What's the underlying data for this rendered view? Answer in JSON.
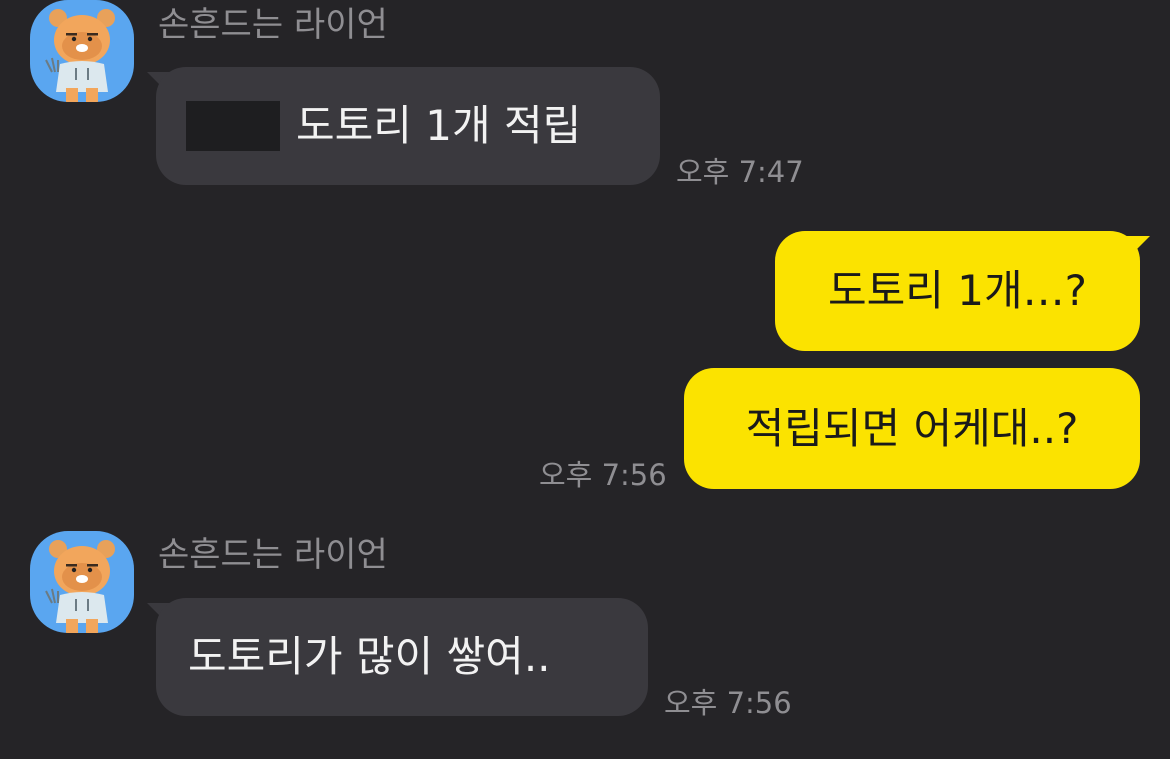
{
  "colors": {
    "background": "#252427",
    "incoming_bubble": "#3a393e",
    "outgoing_bubble": "#fbe300",
    "avatar_bg": "#5aa6f0",
    "meta_text": "#8f8e92"
  },
  "messages": {
    "m1": {
      "sender": "손흔드는 라이언",
      "avatar_icon": "ryan-character-icon",
      "text": "도토리 1개 적립",
      "has_redacted_prefix": true,
      "time": "오후 7:47"
    },
    "m2": {
      "text": "도토리 1개…?"
    },
    "m3": {
      "text": "적립되면 어케대..?",
      "time": "오후 7:56"
    },
    "m4": {
      "sender": "손흔드는 라이언",
      "avatar_icon": "ryan-character-icon",
      "text": "도토리가 많이 쌓여..",
      "time": "오후 7:56"
    }
  }
}
